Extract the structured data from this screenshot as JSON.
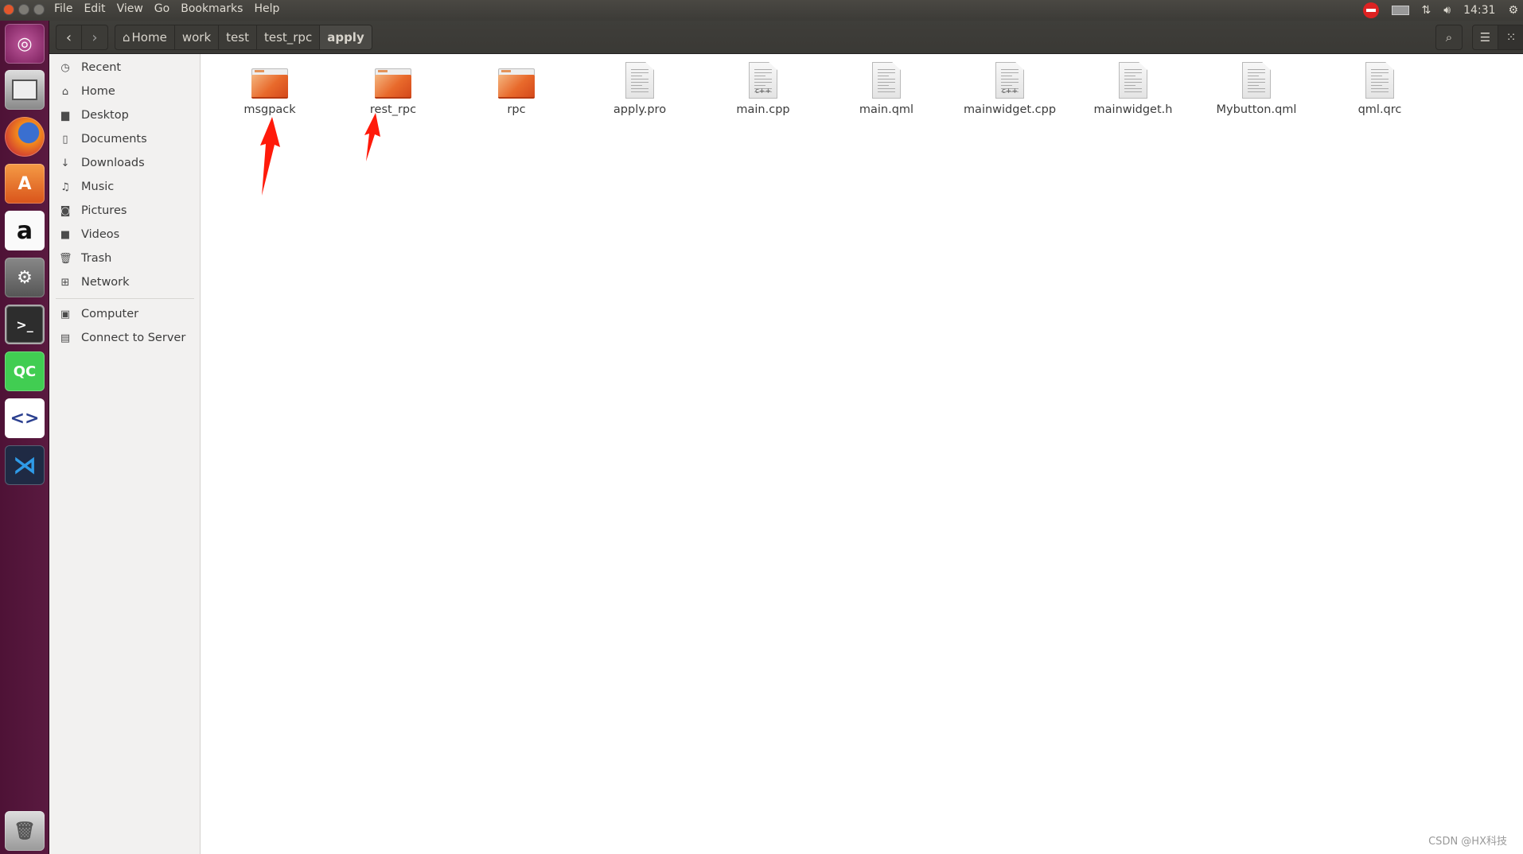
{
  "menu": [
    "File",
    "Edit",
    "View",
    "Go",
    "Bookmarks",
    "Help"
  ],
  "tray": {
    "clock": "14:31"
  },
  "launcher": [
    "ubuntu-dash",
    "files",
    "firefox",
    "software-center",
    "amazon",
    "system-settings",
    "terminal",
    "qt-creator",
    "code-editor",
    "vscode",
    "trash"
  ],
  "breadcrumb": [
    "Home",
    "work",
    "test",
    "test_rpc",
    "apply"
  ],
  "sidebar": {
    "places": [
      "Recent",
      "Home",
      "Desktop",
      "Documents",
      "Downloads",
      "Music",
      "Pictures",
      "Videos",
      "Trash",
      "Network"
    ],
    "devices": [
      "Computer",
      "Connect to Server"
    ]
  },
  "files": [
    {
      "name": "msgpack",
      "type": "folder"
    },
    {
      "name": "rest_rpc",
      "type": "folder"
    },
    {
      "name": "rpc",
      "type": "folder"
    },
    {
      "name": "apply.pro",
      "type": "text"
    },
    {
      "name": "main.cpp",
      "type": "cpp"
    },
    {
      "name": "main.qml",
      "type": "text"
    },
    {
      "name": "mainwidget.cpp",
      "type": "cpp"
    },
    {
      "name": "mainwidget.h",
      "type": "header"
    },
    {
      "name": "Mybutton.qml",
      "type": "text"
    },
    {
      "name": "qml.qrc",
      "type": "text"
    }
  ],
  "annotation_color": "#ff1a0a",
  "watermark": "CSDN @HX科技"
}
